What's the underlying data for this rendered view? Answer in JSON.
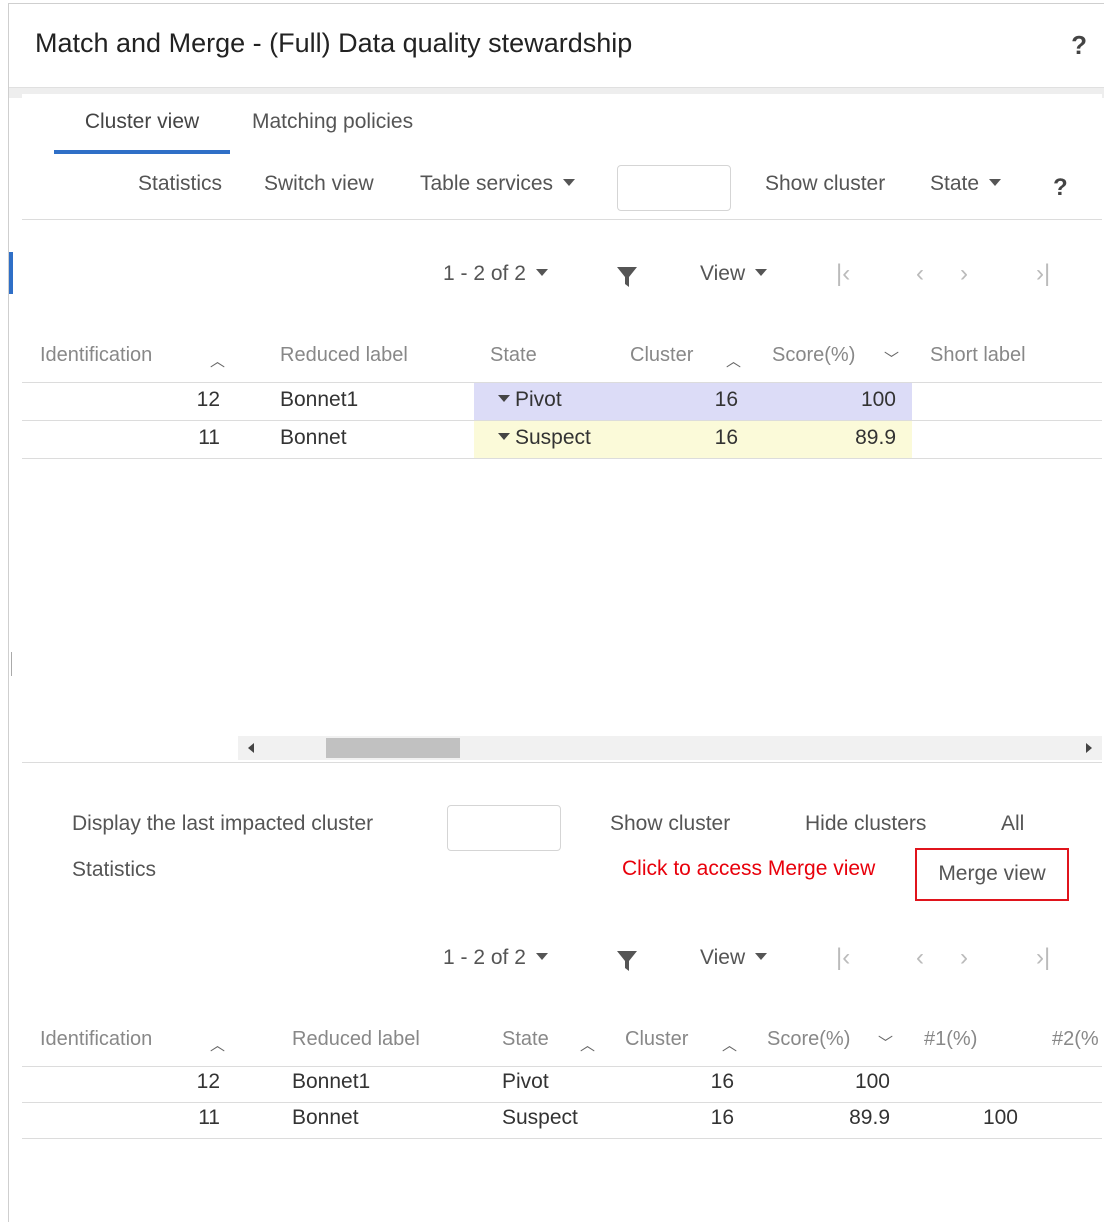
{
  "window": {
    "title": "Match and Merge - (Full) Data quality stewardship",
    "help": "?"
  },
  "tabs": [
    {
      "label": "Cluster view",
      "active": true
    },
    {
      "label": "Matching policies",
      "active": false
    }
  ],
  "toolbar": {
    "statistics": "Statistics",
    "switch_view": "Switch view",
    "table_services": "Table services",
    "search_value": "",
    "show_cluster": "Show cluster",
    "state": "State",
    "help": "?"
  },
  "top_table": {
    "pager": "1 - 2 of 2",
    "view": "View",
    "columns": [
      "Identification",
      "Reduced label",
      "State",
      "Cluster",
      "Score(%)",
      "Short label"
    ],
    "rows": [
      {
        "identification": "12",
        "reduced_label": "Bonnet1",
        "state": "Pivot",
        "cluster": "16",
        "score": "100",
        "short_label": ""
      },
      {
        "identification": "11",
        "reduced_label": "Bonnet",
        "state": "Suspect",
        "cluster": "16",
        "score": "89.9",
        "short_label": ""
      }
    ],
    "state_colors": {
      "Pivot": "#dcdcf7",
      "Suspect": "#fbfad9"
    }
  },
  "bottom_toolbar": {
    "display_last": "Display the last impacted cluster",
    "cluster_input_value": "",
    "show_cluster": "Show cluster",
    "hide_clusters": "Hide clusters",
    "all": "All",
    "statistics": "Statistics",
    "note": "Click to access Merge view",
    "merge_view": "Merge view"
  },
  "bottom_table": {
    "pager": "1 - 2 of 2",
    "view": "View",
    "columns": [
      "Identification",
      "Reduced label",
      "State",
      "Cluster",
      "Score(%)",
      "#1(%)",
      "#2(%"
    ],
    "rows": [
      {
        "identification": "12",
        "reduced_label": "Bonnet1",
        "state": "Pivot",
        "cluster": "16",
        "score": "100",
        "p1": "",
        "p2": ""
      },
      {
        "identification": "11",
        "reduced_label": "Bonnet",
        "state": "Suspect",
        "cluster": "16",
        "score": "89.9",
        "p1": "100",
        "p2": ""
      }
    ]
  },
  "colors": {
    "accent": "#2f6fc7",
    "highlight_red": "#e8000b"
  }
}
